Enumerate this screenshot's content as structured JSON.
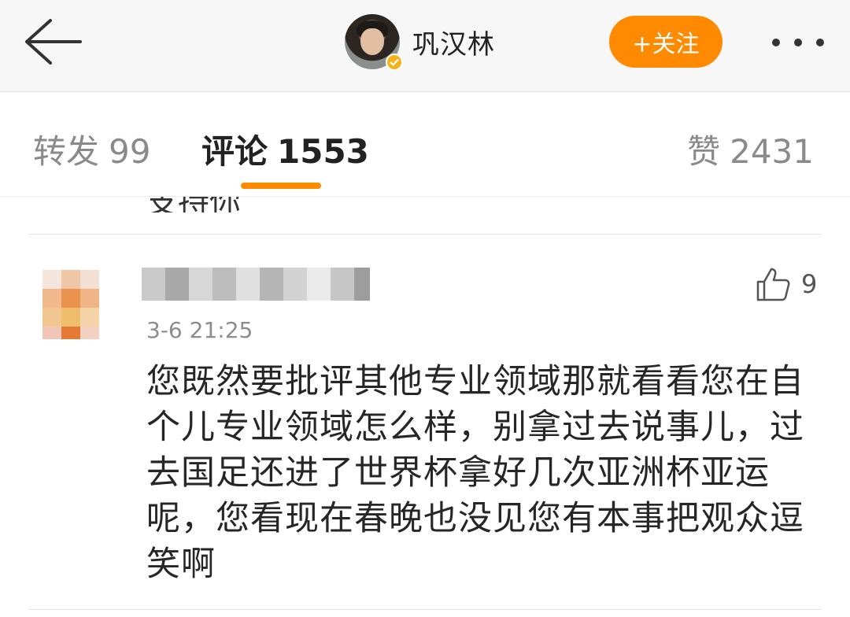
{
  "header": {
    "username": "巩汉林",
    "follow_label": "+关注",
    "accent_color": "#ff8a00",
    "verified_color": "#f5b21a"
  },
  "tabs": {
    "repost_label": "转发",
    "repost_count": "99",
    "comment_label": "评论",
    "comment_count": "1553",
    "like_label": "赞",
    "like_count": "2431",
    "active": "comment"
  },
  "previous_comment": {
    "tail_text": "支持你"
  },
  "comment": {
    "time": "3-6 21:25",
    "likes": "9",
    "text": "您既然要批评其他专业领域那就看看您在自个儿专业领域怎么样，别拿过去说事儿，过去国足还进了世界杯拿好几次亚洲杯亚运呢，您看现在春晚也没见您有本事把观众逗笑啊"
  },
  "icons": {
    "back": "back-arrow-icon",
    "more": "more-dots-icon",
    "like": "thumbs-up-icon",
    "verified": "verified-badge-icon"
  }
}
